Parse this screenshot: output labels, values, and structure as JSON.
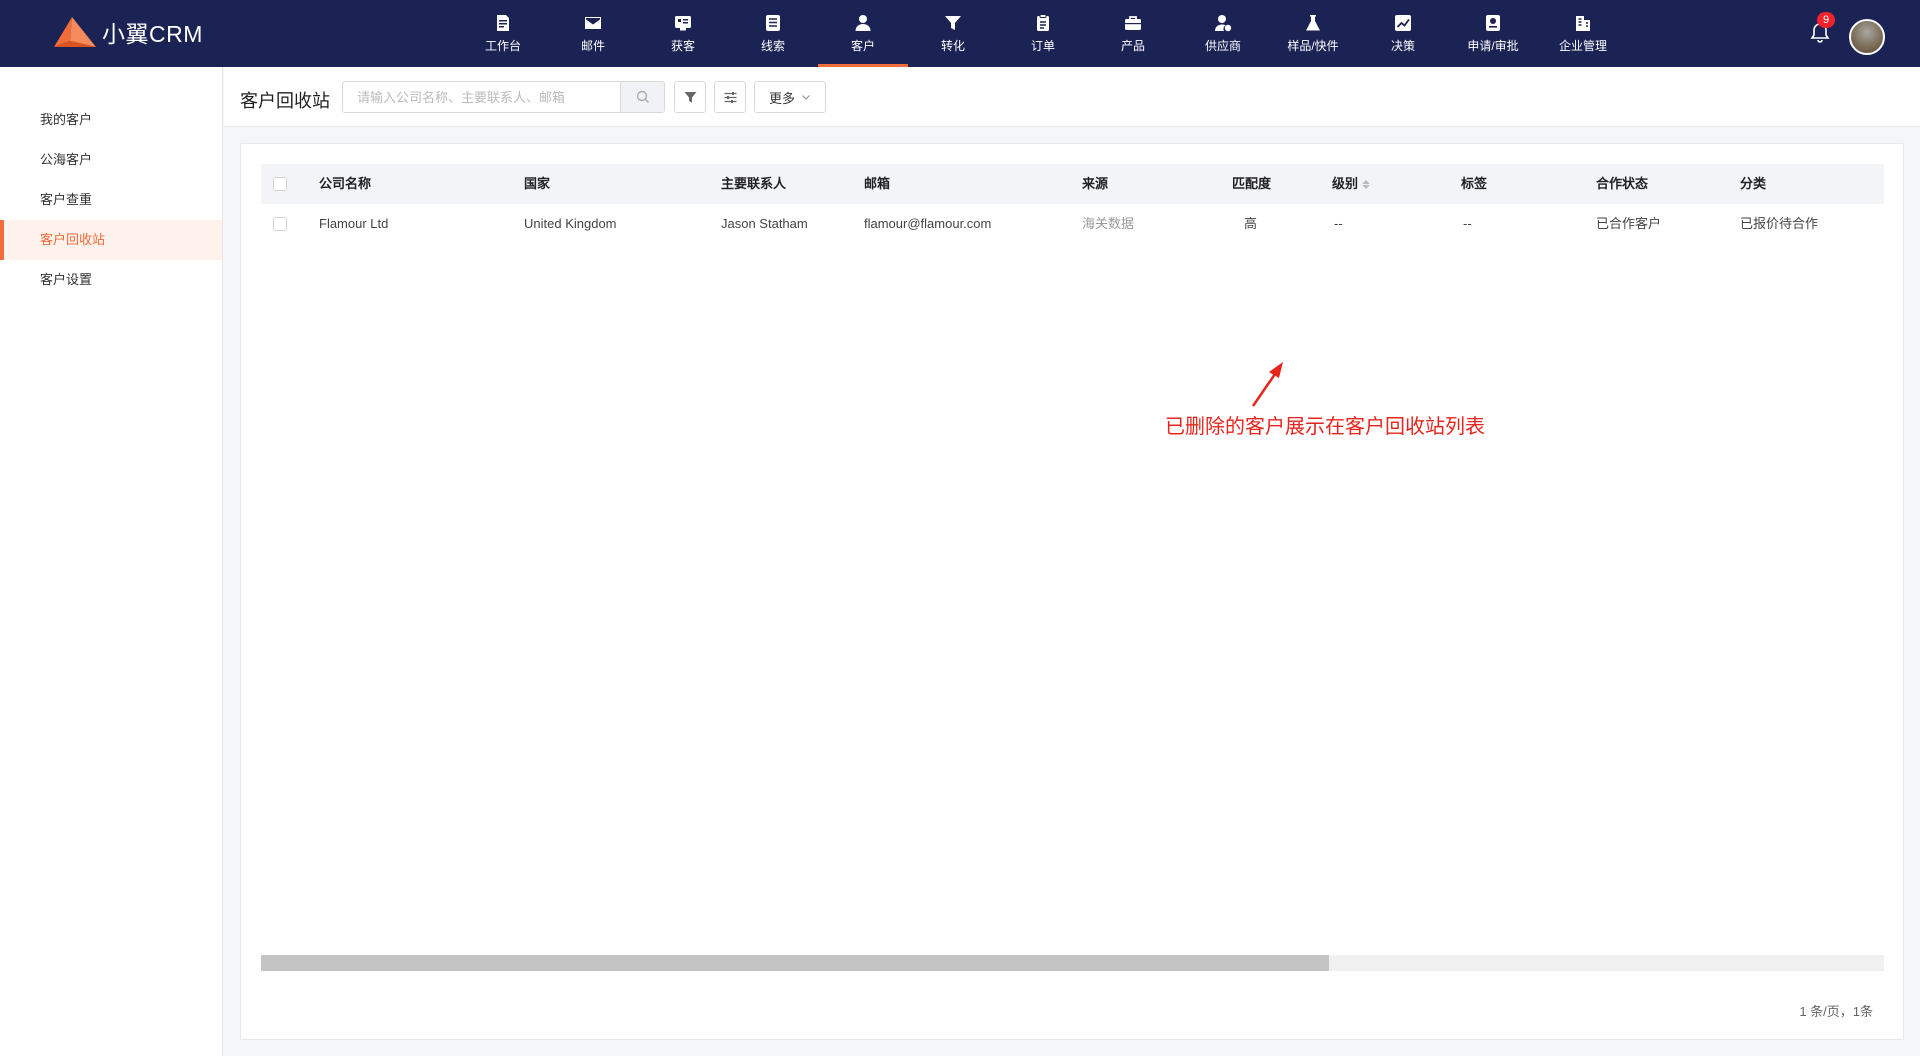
{
  "app": {
    "logo_text": "小翼CRM",
    "brand_color": "#f26b3a",
    "nav_bg": "#1b2254"
  },
  "nav": {
    "items": [
      {
        "label": "工作台",
        "icon": "dashboard-icon"
      },
      {
        "label": "邮件",
        "icon": "mail-icon"
      },
      {
        "label": "获客",
        "icon": "acquire-icon"
      },
      {
        "label": "线索",
        "icon": "clue-icon"
      },
      {
        "label": "客户",
        "icon": "user-icon",
        "active": true
      },
      {
        "label": "转化",
        "icon": "funnel-icon"
      },
      {
        "label": "订单",
        "icon": "clipboard-icon"
      },
      {
        "label": "产品",
        "icon": "briefcase-icon"
      },
      {
        "label": "供应商",
        "icon": "supplier-icon"
      },
      {
        "label": "样品/快件",
        "icon": "flask-icon"
      },
      {
        "label": "决策",
        "icon": "chart-icon"
      },
      {
        "label": "申请/审批",
        "icon": "approval-icon"
      },
      {
        "label": "企业管理",
        "icon": "building-icon"
      }
    ],
    "notification_count": "9"
  },
  "sidebar": {
    "items": [
      {
        "label": "我的客户"
      },
      {
        "label": "公海客户"
      },
      {
        "label": "客户查重"
      },
      {
        "label": "客户回收站",
        "active": true
      },
      {
        "label": "客户设置"
      }
    ]
  },
  "toolbar": {
    "title": "客户回收站",
    "search_placeholder": "请输入公司名称、主要联系人、邮箱",
    "more_label": "更多"
  },
  "table": {
    "columns": [
      "公司名称",
      "国家",
      "主要联系人",
      "邮箱",
      "来源",
      "匹配度",
      "级别",
      "标签",
      "合作状态",
      "分类"
    ],
    "rows": [
      {
        "company": "Flamour Ltd",
        "country": "United Kingdom",
        "contact": "Jason Statham",
        "email": "flamour@flamour.com",
        "source": "海关数据",
        "match": "高",
        "level": "--",
        "tag": "--",
        "status": "已合作客户",
        "category": "已报价待合作"
      }
    ]
  },
  "annotation": {
    "text": "已删除的客户展示在客户回收站列表",
    "color": "#e8251d"
  },
  "pagination": {
    "text": "1 条/页，1条"
  }
}
